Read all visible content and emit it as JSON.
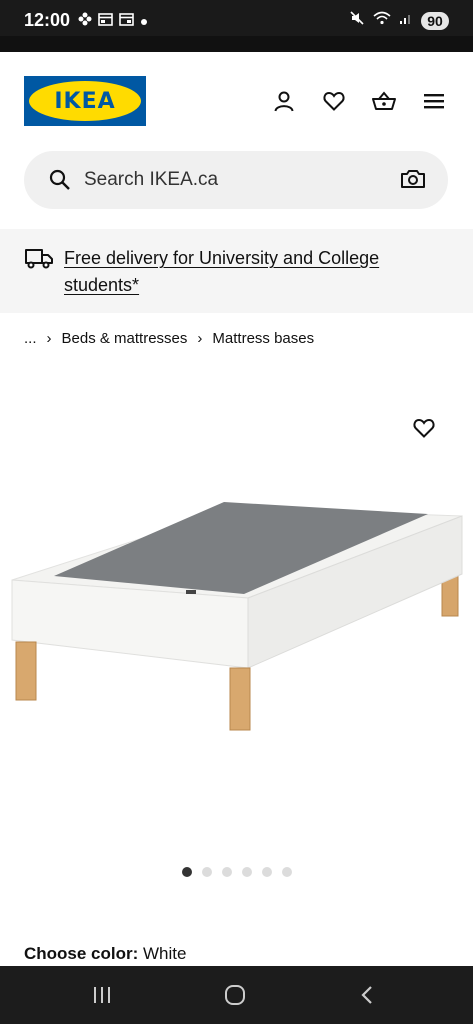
{
  "status_bar": {
    "time": "12:00",
    "battery": "90",
    "icons_left": [
      "flower-icon",
      "calendar-icon",
      "calendar-icon",
      "dot-icon"
    ],
    "icons_right": [
      "mute-icon",
      "wifi-icon",
      "signal-icon"
    ]
  },
  "header": {
    "logo_text": "IKEA",
    "brand_blue": "#0058a3",
    "brand_yellow": "#ffdb00",
    "icons": [
      "account-icon",
      "favorites-icon",
      "basket-icon",
      "menu-icon"
    ]
  },
  "search": {
    "placeholder": "Search IKEA.ca"
  },
  "banner": {
    "text": "Free delivery for University and College students*"
  },
  "breadcrumb": {
    "items": [
      "...",
      "Beds & mattresses",
      "Mattress bases"
    ]
  },
  "carousel": {
    "total": 6,
    "active_index": 0
  },
  "product": {
    "color_label": "Choose color:",
    "color_value": "White"
  }
}
